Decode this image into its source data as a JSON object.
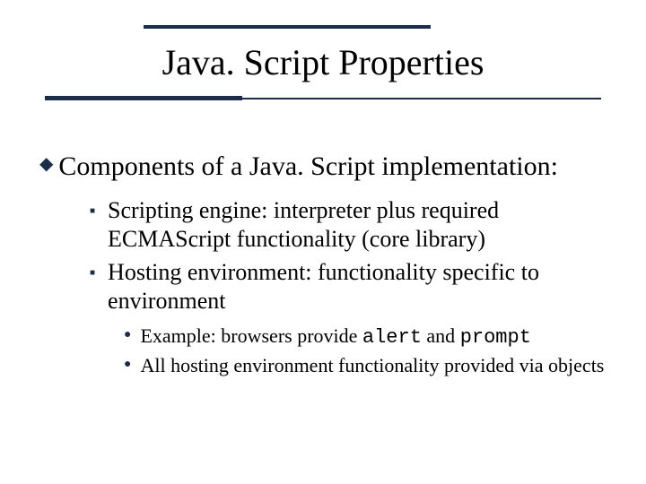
{
  "title": "Java. Script Properties",
  "bullets": {
    "l1": "Components of a Java. Script implementation:",
    "l2a": "Scripting engine: interpreter plus required ECMAScript functionality (core library)",
    "l2b": "Hosting environment: functionality specific to environment",
    "l3a_pre": "Example: browsers provide ",
    "l3a_code1": "alert",
    "l3a_mid": " and ",
    "l3a_code2": "prompt",
    "l3b": "All hosting environment functionality provided via objects"
  }
}
